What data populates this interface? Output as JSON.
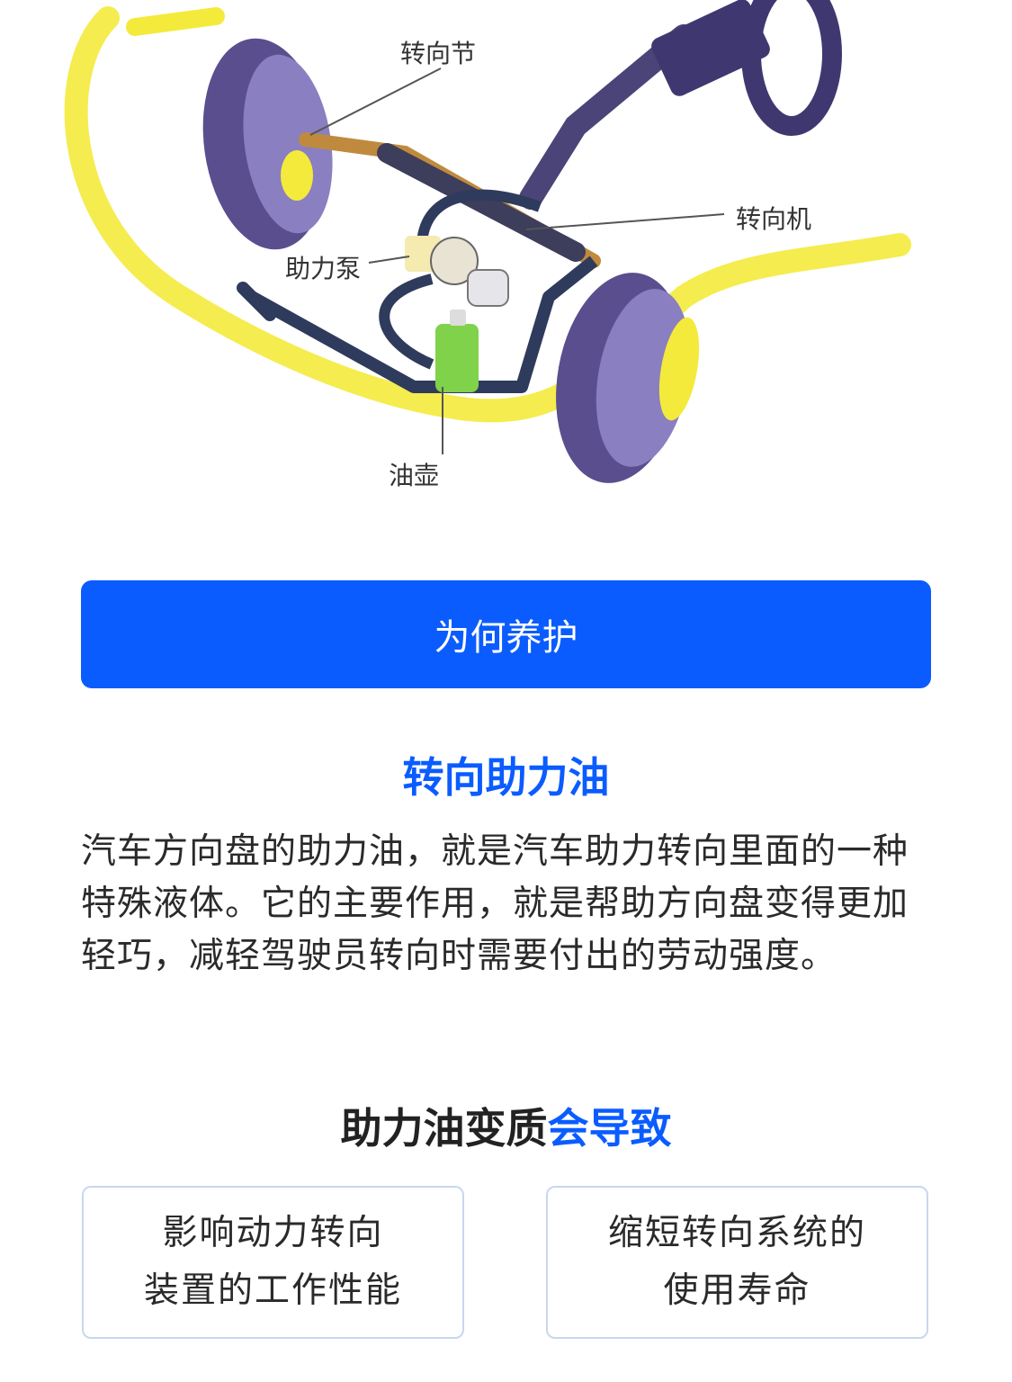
{
  "diagram": {
    "labels": {
      "knuckle": "转向节",
      "steering_gear": "转向机",
      "pump": "助力泵",
      "reservoir": "油壶"
    }
  },
  "cta": {
    "label": "为何养护",
    "color": "#0a5cff"
  },
  "intro": {
    "title": "转向助力油",
    "title_color": "#0a5cff",
    "paragraph": "汽车方向盘的助力油，就是汽车助力转向里面的一种特殊液体。它的主要作用，就是帮助方向盘变得更加轻巧，减轻驾驶员转向时需要付出的劳动强度。"
  },
  "consequences": {
    "title_part1": "助力油变质",
    "title_part2": "会导致",
    "accent_color": "#0a5cff",
    "cards": [
      {
        "line1": "影响动力转向",
        "line2": "装置的工作性能"
      },
      {
        "line1": "缩短转向系统的",
        "line2": "使用寿命"
      }
    ]
  }
}
